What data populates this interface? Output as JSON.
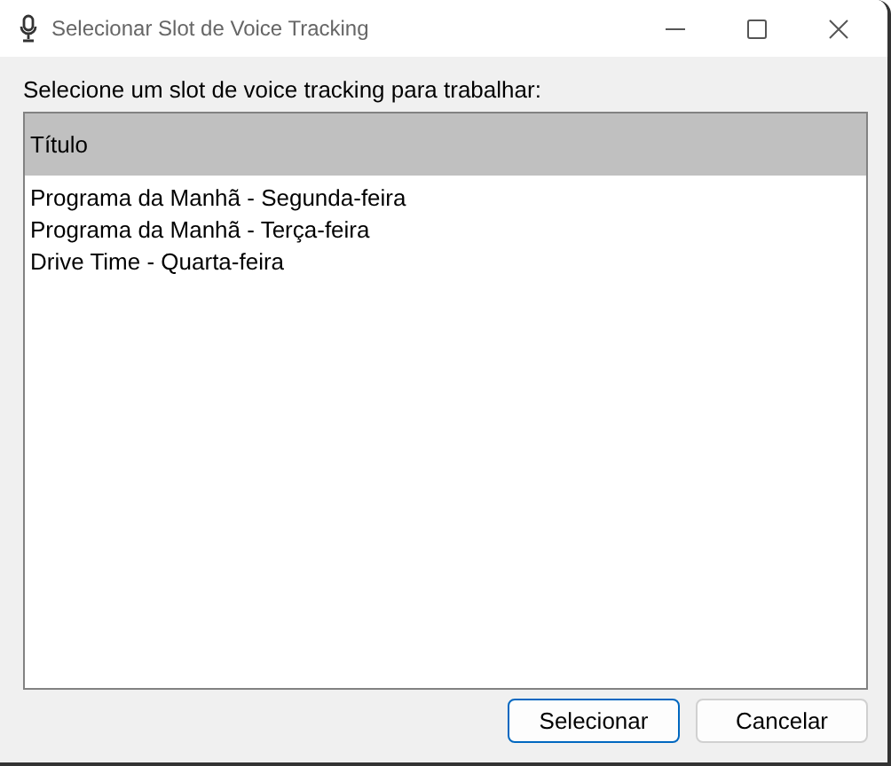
{
  "window": {
    "title": "Selecionar Slot de Voice Tracking"
  },
  "prompt": "Selecione um slot de voice tracking para trabalhar:",
  "list": {
    "columns": [
      "Título"
    ],
    "rows": [
      "Programa da Manhã - Segunda-feira",
      "Programa da Manhã - Terça-feira",
      "Drive Time - Quarta-feira"
    ]
  },
  "buttons": [
    {
      "label": "Selecionar",
      "kind": "default"
    },
    {
      "label": "Cancelar",
      "kind": "normal"
    }
  ]
}
